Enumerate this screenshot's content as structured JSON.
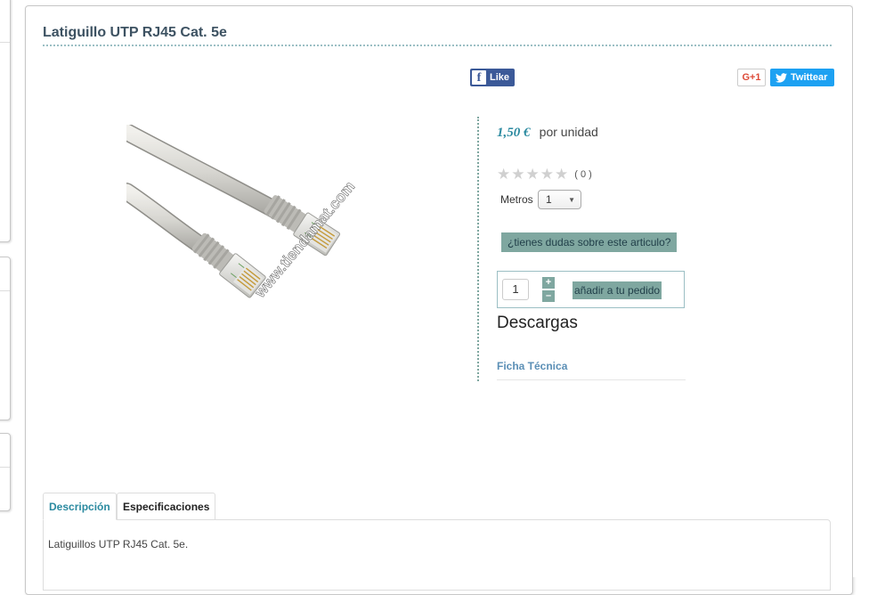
{
  "product": {
    "title": "Latiguillo UTP RJ45 Cat. 5e",
    "price": "1,50 €",
    "price_unit": "por unidad",
    "rating_count": "( 0 )",
    "rating_stars": 0,
    "rating_max": 5,
    "image_watermark": "www.tiendamat.com"
  },
  "social": {
    "facebook_label": "Like",
    "gplus_label": "G+1",
    "twitter_label": "Twittear"
  },
  "options": {
    "metros_label": "Metros",
    "metros_value": "1"
  },
  "ask_button": "¿tienes dudas sobre este articulo?",
  "cart": {
    "quantity": "1",
    "plus": "+",
    "minus": "–",
    "add_label": "añadir a tu pedido"
  },
  "downloads": {
    "title": "Descargas",
    "items": [
      "Ficha Técnica"
    ]
  },
  "tabs": {
    "items": [
      "Descripción",
      "Especificaciones"
    ],
    "active_content": "Latiguillos UTP RJ45 Cat. 5e."
  },
  "colors": {
    "accent": "#7fa7a0",
    "title": "#3d5262",
    "price": "#2b8aa0",
    "facebook": "#3b5998",
    "twitter": "#1da1f2"
  }
}
